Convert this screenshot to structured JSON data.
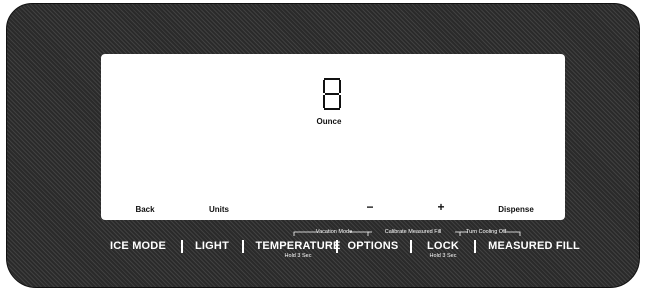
{
  "display": {
    "digit": "8",
    "unit_label": "Ounce",
    "touch_buttons": {
      "back": "Back",
      "units": "Units",
      "minus": "−",
      "plus": "+",
      "dispense": "Dispense"
    }
  },
  "annotations": {
    "vacation_mode": "Vacation Mode",
    "calibrate_measured_fill": "Calibrate Measured Fill",
    "turn_cooling_off": "Turn Cooling Off"
  },
  "controls": {
    "ice_mode": "ICE MODE",
    "light": "LIGHT",
    "temperature": "TEMPERATURE",
    "temperature_hint": "Hold 3 Sec",
    "options": "OPTIONS",
    "lock": "LOCK",
    "lock_hint": "Hold 3 Sec",
    "measured_fill": "MEASURED FILL"
  },
  "colors": {
    "panel": "#2a2a2a",
    "screen": "#ffffff",
    "button_text": "#ffffff"
  }
}
